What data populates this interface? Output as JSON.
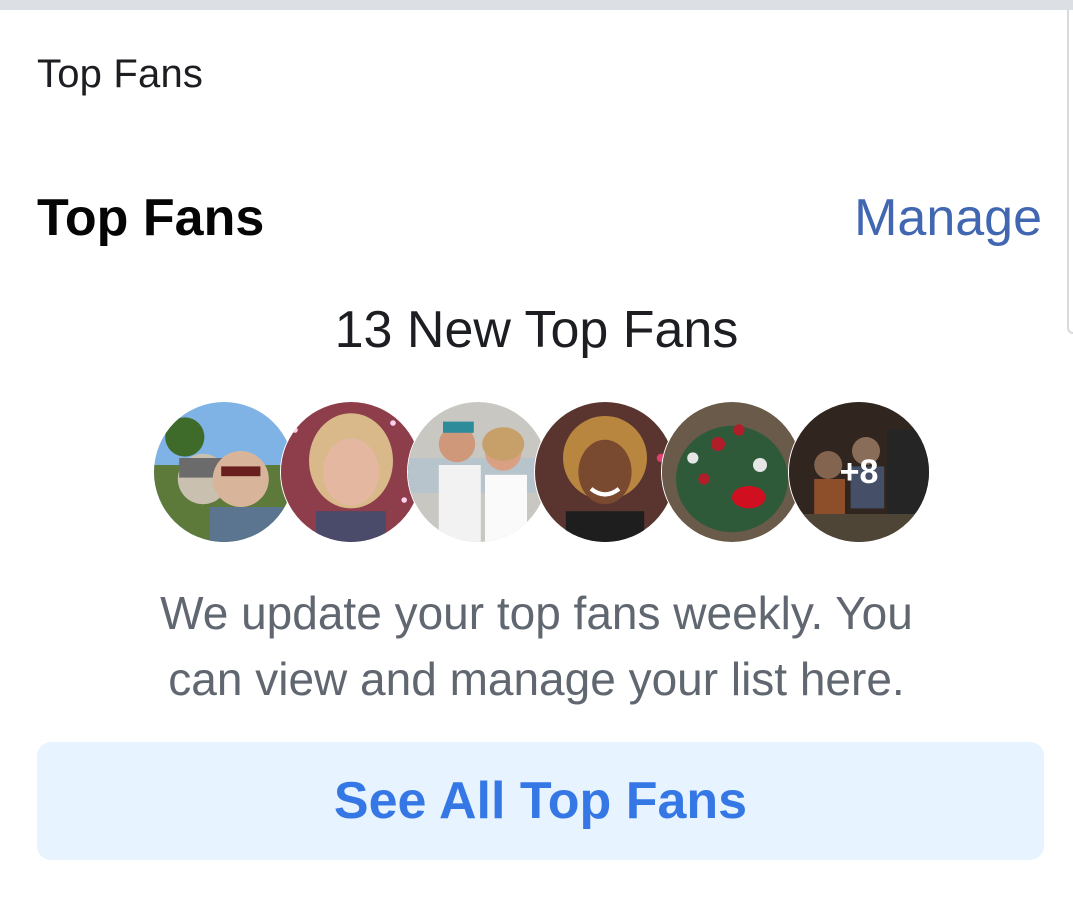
{
  "section": {
    "label": "Top Fans"
  },
  "card": {
    "title": "Top Fans",
    "manage_label": "Manage",
    "new_fans_text": "13 New Top Fans",
    "more_count": "+8",
    "info_line1": "We update your top fans weekly. You",
    "info_line2": "can view and manage your list here.",
    "see_all_label": "See All Top Fans"
  },
  "colors": {
    "link": "#4267b2",
    "button_bg": "#e7f3ff",
    "button_text": "#3578e5",
    "secondary_text": "#606770"
  }
}
